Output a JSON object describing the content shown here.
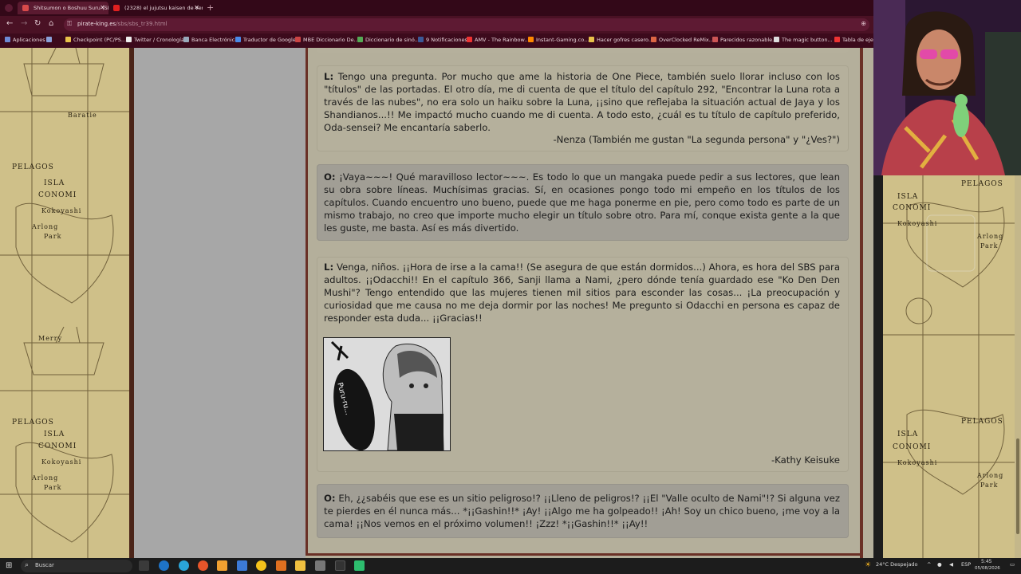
{
  "browser": {
    "tabs": [
      {
        "title": "Shitsumon o Boshuu Suru (SBS) ..."
      },
      {
        "title": "(2328) el jujutsu kaisen de vert..."
      }
    ],
    "new_tab": "+",
    "url_host": "pirate-king.es",
    "url_path": "/sbs/sbs_tr39.html",
    "bookmarks": [
      "Aplicaciones",
      "Checkpoint (PC/PS...",
      "Twitter / Cronología",
      "Banca Electrónica",
      "Traductor de Google",
      "MBE Diccionario De...",
      "Diccionario de sinó...",
      "9 Notificaciones",
      "AMV - The Rainbow...",
      "Instant-Gaming.co...",
      "Hacer gofres casero...",
      "OverClocked ReMix...",
      "Parecidos razonable...",
      "The magic button...",
      "Tabla de ejer..."
    ]
  },
  "map": {
    "left_labels": [
      "Baratie",
      "PELAGOS",
      "ISLA",
      "CONOMI",
      "Kokoyashi",
      "Arlong",
      "Park",
      "Merry",
      "PELAGOS",
      "ISLA",
      "CONOMI",
      "Kokoyashi",
      "Arlong",
      "Park"
    ],
    "right_labels": [
      "PELAGOS",
      "ISLA",
      "CONOMI",
      "Kokoyashi",
      "Arlong",
      "Park",
      "PELAGOS",
      "ISLA",
      "CONOMI",
      "Kokoyashi",
      "Arlong",
      "Park"
    ]
  },
  "sbs": {
    "q1": {
      "prefix": "L:",
      "text": "Tengo una pregunta. Por mucho que ame la historia de One Piece, también suelo llorar incluso con los \"títulos\" de las portadas. El otro día, me di cuenta de que el título del capítulo 292, \"Encontrar la Luna rota a través de las nubes\", no era solo un haiku sobre la Luna, ¡¡sino que reflejaba la situación actual de Jaya y los Shandianos...!! Me impactó mucho cuando me di cuenta. A todo esto, ¿cuál es tu título de capítulo preferido, Oda-sensei? Me encantaría saberlo.",
      "signature": "-Nenza (También me gustan \"La segunda persona\" y \"¿Ves?\")"
    },
    "a1": {
      "prefix": "O:",
      "text": "¡Vaya~~~! Qué maravilloso lector~~~. Es todo lo que un mangaka puede pedir a sus lectores, que lean su obra sobre líneas. Muchísimas gracias. Sí, en ocasiones pongo todo mi empeño en los títulos de los capítulos. Cuando encuentro uno bueno, puede que me haga ponerme en pie, pero como todo es parte de un mismo trabajo, no creo que importe mucho elegir un título sobre otro. Para mí, conque exista gente a la que les guste, me basta. Así es más divertido."
    },
    "q2": {
      "prefix": "L:",
      "text": "Venga, niños. ¡¡Hora de irse a la cama!! (Se asegura de que están dormidos...) Ahora, es hora del SBS para adultos. ¡¡Odacchi!! En el capítulo 366, Sanji llama a Nami, ¿pero dónde tenía guardado ese \"Ko Den Den Mushi\"? Tengo entendido que las mujeres tienen mil sitios para esconder las cosas... ¡La preocupación y curiosidad que me causa no me deja dormir por las noches! Me pregunto si Odacchi en persona es capaz de responder esta duda... ¡¡Gracias!!",
      "image_sfx": "Puru-ru...",
      "signature": "-Kathy Keisuke"
    },
    "a2": {
      "prefix": "O:",
      "text": "Eh, ¿¿sabéis que ese es un sitio peligroso!? ¡¡Lleno de peligros!? ¡¡El \"Valle oculto de Nami\"!? Si alguna vez te pierdes en él nunca más... *¡¡Gashin!!* ¡Ay! ¡¡Algo me ha golpeado!! ¡Ah! Soy un chico bueno, ¡me voy a la cama! ¡¡Nos vemos en el próximo volumen!! ¡Zzz! *¡¡Gashin!!* ¡¡Ay!!"
    }
  },
  "taskbar": {
    "search_placeholder": "Buscar",
    "weather": "24°C  Despejado",
    "lang": "ESP",
    "time": "5:45",
    "date": "05/08/2026"
  },
  "colors": {
    "chrome": "#3c0a1c",
    "parchment": "#cfc089",
    "question_box": "#b5b09c",
    "answer_box": "#a19e95",
    "frame": "#6a3026"
  }
}
